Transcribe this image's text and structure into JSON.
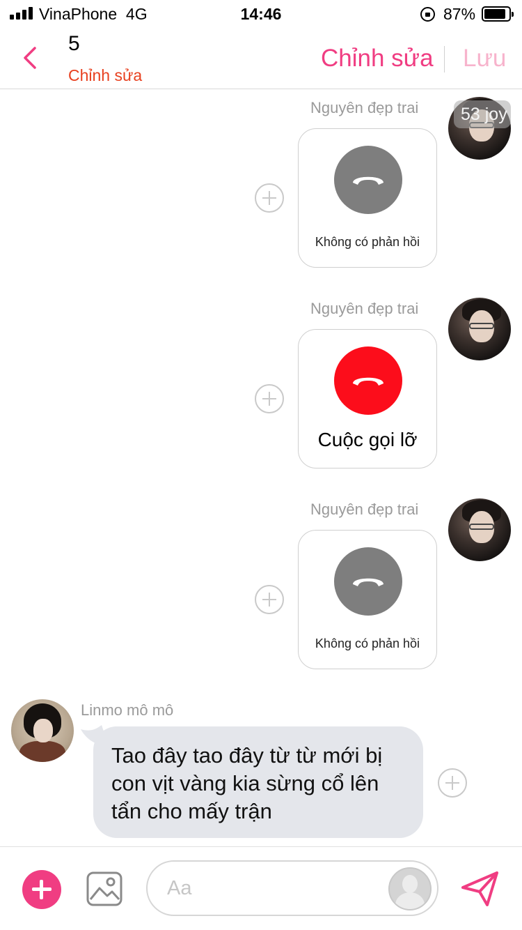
{
  "status_bar": {
    "carrier": "VinaPhone",
    "network": "4G",
    "time": "14:46",
    "battery_percent": "87%",
    "battery_level": 0.87
  },
  "header": {
    "title": "5",
    "subtitle": "Chỉnh sửa",
    "edit_label": "Chỉnh sửa",
    "save_label": "Lưu",
    "accent_color": "#f03d82",
    "subtitle_color": "#e8401f"
  },
  "messages": [
    {
      "sender": "Nguyên đẹp trai",
      "type": "call",
      "status_color": "gray",
      "caption": "Không có phản hồi",
      "timestamp_badge": "53 joy"
    },
    {
      "sender": "Nguyên đẹp trai",
      "type": "call",
      "status_color": "red",
      "caption": "Cuộc gọi lỡ"
    },
    {
      "sender": "Nguyên đẹp trai",
      "type": "call",
      "status_color": "gray",
      "caption": "Không có phản hồi"
    },
    {
      "sender": "Linmo mô mô",
      "type": "text",
      "lines": [
        "Tao đây tao đây từ từ mới bị",
        "con vịt vàng kia sừng cổ lên",
        "tẩn cho mấy trận"
      ]
    }
  ],
  "composer": {
    "placeholder": "Aa",
    "icons": [
      "plus-icon",
      "gallery-icon",
      "sticker-avatar-icon",
      "send-icon"
    ]
  }
}
